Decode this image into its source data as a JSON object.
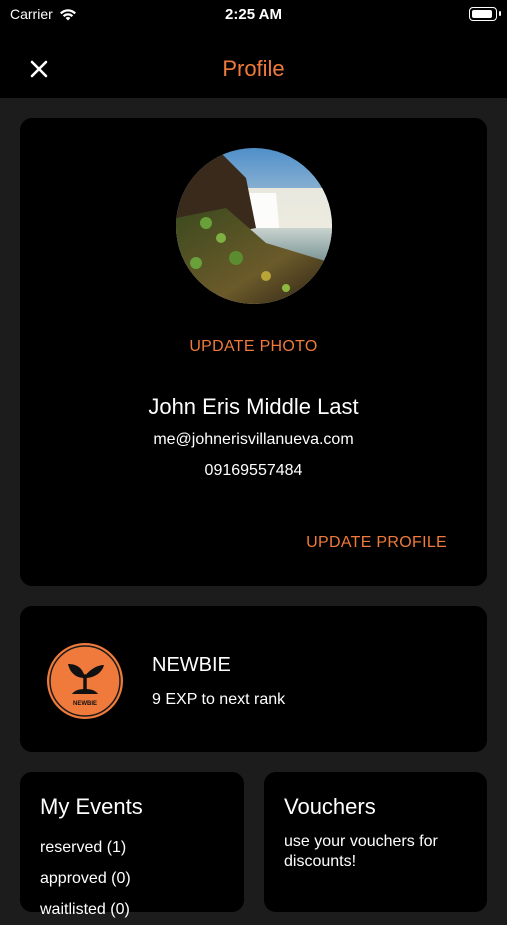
{
  "status_bar": {
    "carrier": "Carrier",
    "time": "2:25 AM",
    "wifi_icon": "wifi-icon",
    "battery_icon": "battery-icon"
  },
  "nav": {
    "title": "Profile",
    "close_icon": "close-icon"
  },
  "profile": {
    "update_photo_label": "UPDATE PHOTO",
    "name": "John Eris Middle Last",
    "email": "me@johnerisvillanueva.com",
    "phone": "09169557484",
    "update_profile_label": "UPDATE PROFILE"
  },
  "rank": {
    "badge_text": "NEWBIE",
    "name": "NEWBIE",
    "subtitle": "9 EXP to next rank"
  },
  "events": {
    "title": "My Events",
    "items": [
      {
        "label": "reserved (1)"
      },
      {
        "label": "approved (0)"
      },
      {
        "label": "waitlisted (0)"
      }
    ]
  },
  "vouchers": {
    "title": "Vouchers",
    "description": "use your vouchers for discounts!"
  },
  "colors": {
    "accent": "#ef7a3b",
    "card_bg": "#000000",
    "page_bg": "#1c1c1c",
    "text": "#ffffff"
  }
}
